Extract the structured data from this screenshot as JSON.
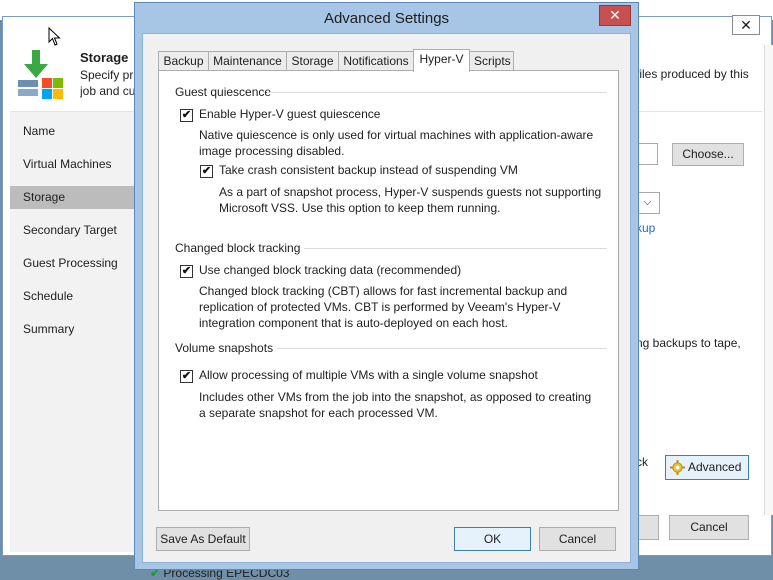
{
  "wizard": {
    "close_glyph": "✕",
    "title": "Storage",
    "desc_line1": "Specify pro",
    "desc_line2": "job and cu",
    "desc_right": "files produced by this",
    "nav": [
      "Name",
      "Virtual Machines",
      "Storage",
      "Secondary Target",
      "Guest Processing",
      "Schedule",
      "Summary"
    ],
    "selected_nav": "Storage",
    "choose_button": "Choose...",
    "select_arrow": "⌵",
    "link_fragment": "kup",
    "tape_text": "ng backups to tape,",
    "advanced_fragment": "ck",
    "advanced_button": "Advanced",
    "cancel_button": "Cancel",
    "status_text": "Processing EPECDC03"
  },
  "dialog": {
    "title": "Advanced Settings",
    "close_glyph": "✕",
    "tabs": [
      "Backup",
      "Maintenance",
      "Storage",
      "Notifications",
      "Hyper-V",
      "Scripts"
    ],
    "active_tab": "Hyper-V",
    "sections": {
      "guest_quiescence": {
        "title": "Guest quiescence",
        "enable_label": "Enable Hyper-V guest quiescence",
        "enable_checked": true,
        "enable_desc_line1": "Native quiescence is only used for virtual machines with application-aware",
        "enable_desc_line2": "image processing disabled.",
        "crash_label": "Take crash consistent backup instead of suspending VM",
        "crash_checked": true,
        "crash_desc_line1": "As a part of snapshot process, Hyper-V suspends guests not supporting",
        "crash_desc_line2": "Microsoft VSS. Use this option to keep them running."
      },
      "changed_block_tracking": {
        "title": "Changed block tracking",
        "cbt_label": "Use changed block tracking data (recommended)",
        "cbt_checked": true,
        "cbt_desc_line1": "Changed block tracking (CBT) allows for fast incremental backup and",
        "cbt_desc_line2": "replication of protected VMs. CBT is performed by Veeam's Hyper-V",
        "cbt_desc_line3": "integration component that is auto-deployed on each host."
      },
      "volume_snapshots": {
        "title": "Volume snapshots",
        "multi_label": "Allow processing of multiple VMs with a single volume snapshot",
        "multi_checked": true,
        "multi_desc_line1": "Includes other VMs from the job into the snapshot, as opposed to creating",
        "multi_desc_line2": "a separate snapshot for each processed VM."
      }
    },
    "check_glyph": "✔",
    "buttons": {
      "save_default": "Save As Default",
      "ok": "OK",
      "cancel": "Cancel"
    }
  },
  "colors": {
    "dialog_frame": "#a7c5e4",
    "close_button": "#c75050",
    "nav_selected": "#bcbcbc",
    "link": "#1a6fc4"
  }
}
